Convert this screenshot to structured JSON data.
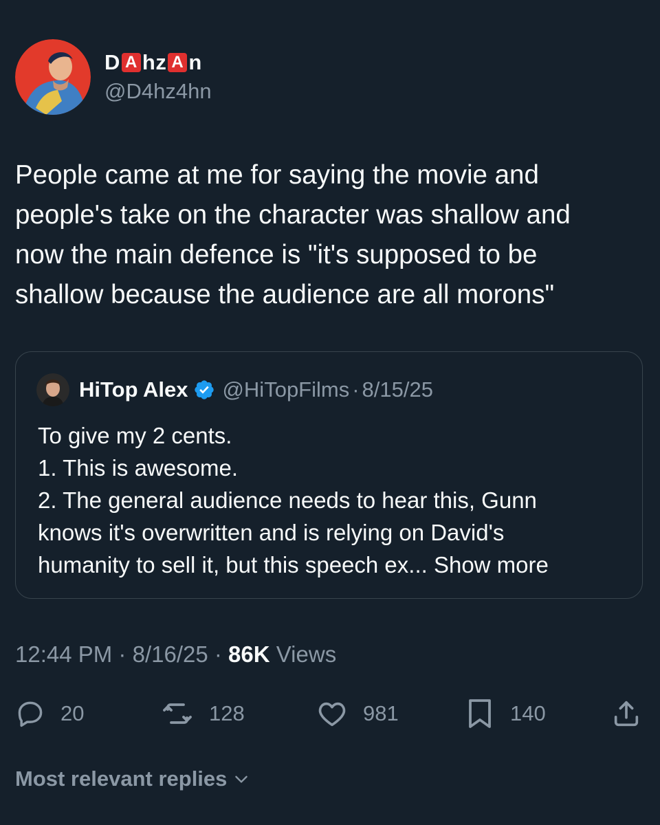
{
  "author": {
    "display_name_parts": [
      "D",
      "A",
      "hz",
      "A",
      "n"
    ],
    "handle": "@D4hz4hn",
    "name_box_color": "#e0302f"
  },
  "tweet": {
    "lines": [
      "People came at me for saying the movie and",
      "people's take on the character was shallow and",
      "now the main defence is \"it's supposed to be",
      "shallow because the audience are all morons\""
    ]
  },
  "quote": {
    "name": "HiTop Alex",
    "verified_icon": "verified-badge-icon",
    "handle": "@HiTopFilms",
    "separator": "·",
    "date": "8/15/25",
    "lines": [
      "To give my 2 cents.",
      "1. This is awesome.",
      "2. The general audience needs to hear this, Gunn",
      "knows it's overwritten and is relying on David's"
    ],
    "last_line": "humanity to sell it, but this speech ex...",
    "show_more": "Show more"
  },
  "meta": {
    "time": "12:44 PM",
    "separator": "·",
    "date": "8/16/25",
    "views_count": "86K",
    "views_label": "Views"
  },
  "actions": {
    "reply": {
      "icon": "reply-icon",
      "count": "20"
    },
    "retweet": {
      "icon": "retweet-icon",
      "count": "128"
    },
    "like": {
      "icon": "heart-icon",
      "count": "981"
    },
    "bookmark": {
      "icon": "bookmark-icon",
      "count": "140"
    },
    "share": {
      "icon": "share-icon"
    }
  },
  "replies": {
    "label": "Most relevant replies"
  },
  "colors": {
    "background": "#15202b",
    "text": "#f7f9f9",
    "muted": "#8b98a5",
    "border": "#38444d",
    "verified": "#1d9bf0"
  }
}
